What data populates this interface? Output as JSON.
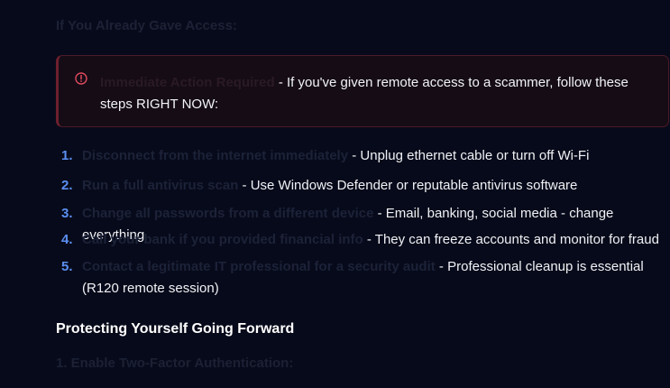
{
  "section_top": {
    "title": "If You Already Gave Access:"
  },
  "alert": {
    "icon": "alert-circle-icon",
    "title": "Immediate Action Required",
    "message": " - If you've given remote access to a scammer, follow these steps RIGHT NOW:"
  },
  "steps": [
    {
      "num": "1.",
      "title": "Disconnect from the internet immediately",
      "desc": " - Unplug ethernet cable or turn off Wi-Fi"
    },
    {
      "num": "2.",
      "title": "Run a full antivirus scan",
      "desc": " - Use Windows Defender or reputable antivirus software"
    },
    {
      "num": "3.",
      "title": "Change all passwords from a different device",
      "desc": " - Email, banking, social media - change everything"
    },
    {
      "num": "4.",
      "title": "Call your bank if you provided financial info",
      "desc": " - They can freeze accounts and monitor for fraud"
    },
    {
      "num": "5.",
      "title": "Contact a legitimate IT professional for a security audit",
      "desc": " - Professional cleanup is essential (R120 remote session)"
    }
  ],
  "section_protect": {
    "title": "Protecting Yourself Going Forward"
  },
  "subsection": {
    "title": "1. Enable Two-Factor Authentication:"
  },
  "colors": {
    "accent": "#5b8ff2",
    "alert_border": "#6d1f2e",
    "alert_icon": "#e0495c",
    "background": "#070a1a"
  }
}
